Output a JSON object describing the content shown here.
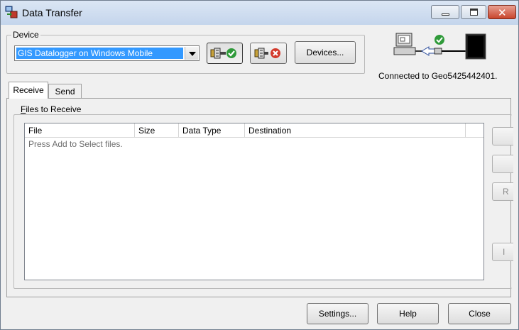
{
  "window": {
    "title": "Data Transfer"
  },
  "device": {
    "group_label": "Device",
    "selected": "GIS Datalogger on Windows Mobile",
    "devices_button": "Devices...",
    "status": "Connected to Geo5425442401."
  },
  "tabs": [
    {
      "label": "Receive",
      "active": true
    },
    {
      "label": "Send",
      "active": false
    }
  ],
  "receive": {
    "group_label": "Files to Receive",
    "columns": [
      "File",
      "Size",
      "Data Type",
      "Destination"
    ],
    "empty_message": "Press Add to Select files.",
    "side_buttons": [
      "",
      "",
      "R",
      "I"
    ]
  },
  "footer": {
    "settings": "Settings...",
    "help": "Help",
    "close": "Close"
  }
}
